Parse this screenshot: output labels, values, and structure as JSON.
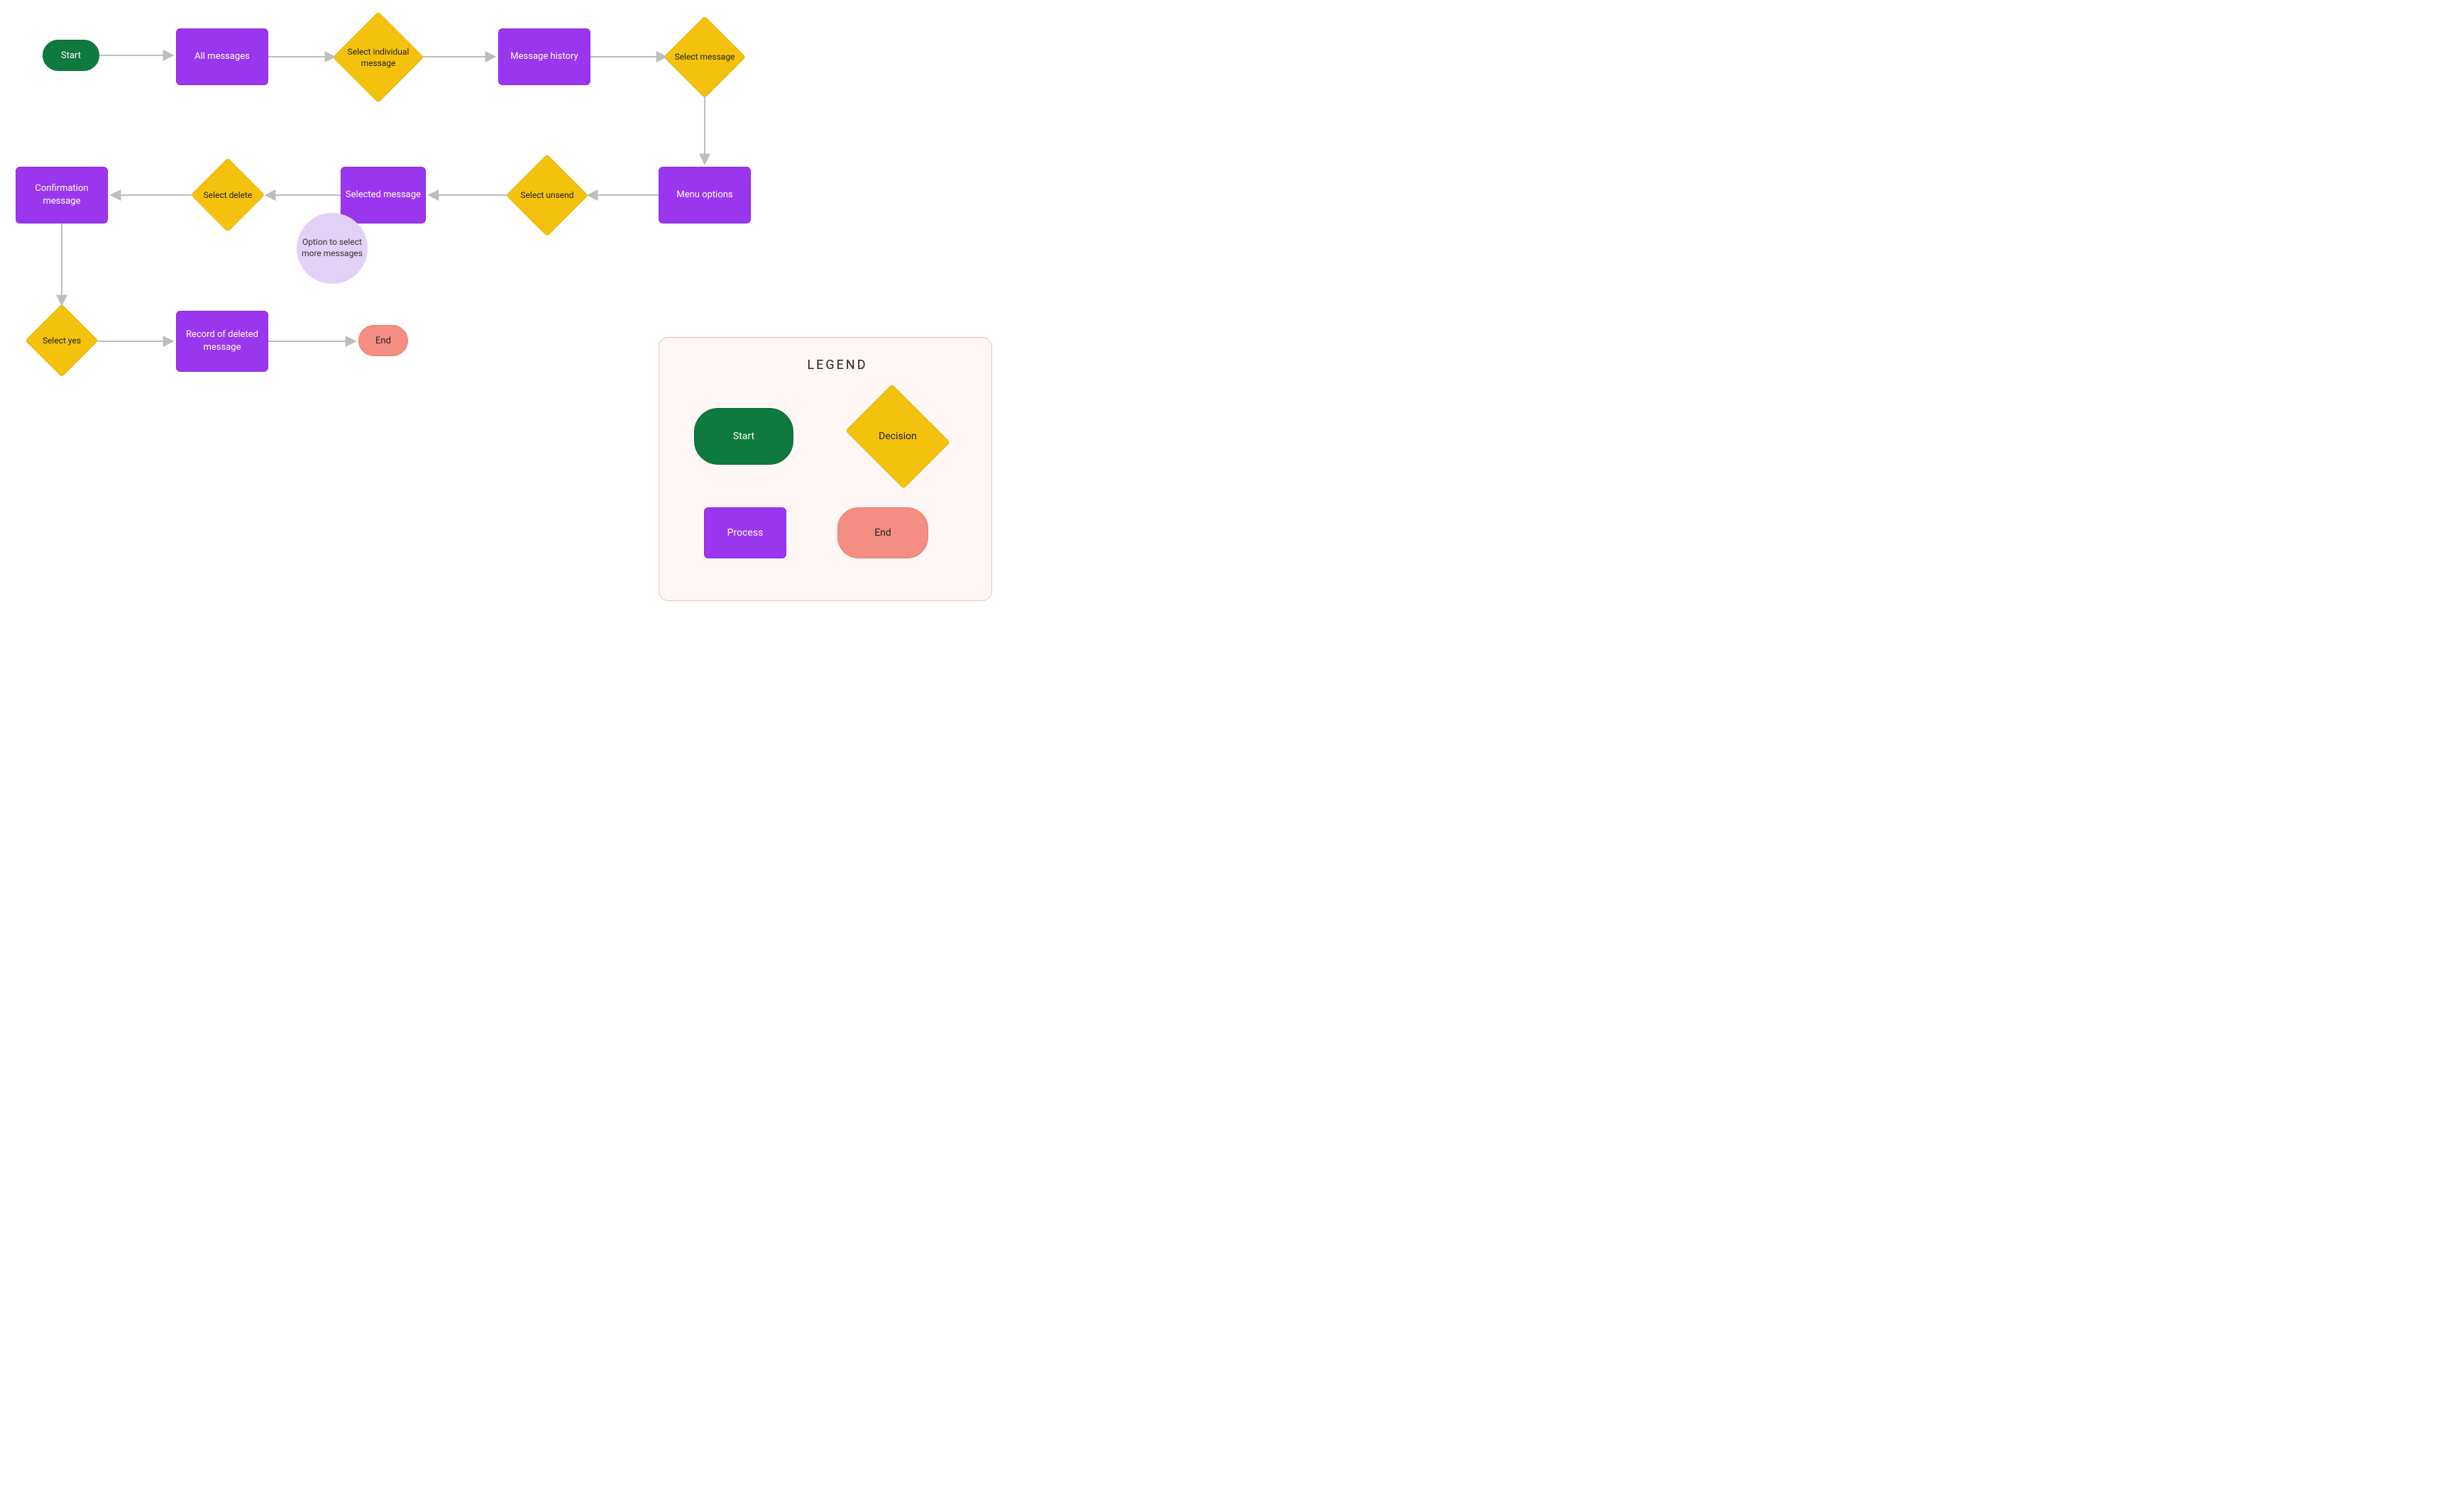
{
  "flow": {
    "start": "Start",
    "all_messages": "All messages",
    "select_individual_message": "Select individual message",
    "message_history": "Message history",
    "select_message": "Select message",
    "menu_options": "Menu options",
    "select_unsend": "Select unsend",
    "selected_message": "Selected message",
    "option_more": "Option to select more messages",
    "select_delete": "Select delete",
    "confirmation_message": "Confirmation message",
    "select_yes": "Select yes",
    "record_deleted": "Record of deleted message",
    "end": "End"
  },
  "legend": {
    "title": "LEGEND",
    "start": "Start",
    "decision": "Decision",
    "process": "Process",
    "end": "End"
  },
  "chart_data": {
    "type": "flowchart",
    "nodes": [
      {
        "id": "start",
        "kind": "start",
        "label": "Start"
      },
      {
        "id": "all_messages",
        "kind": "process",
        "label": "All messages"
      },
      {
        "id": "select_individual_message",
        "kind": "decision",
        "label": "Select individual message"
      },
      {
        "id": "message_history",
        "kind": "process",
        "label": "Message history"
      },
      {
        "id": "select_message",
        "kind": "decision",
        "label": "Select message"
      },
      {
        "id": "menu_options",
        "kind": "process",
        "label": "Menu options"
      },
      {
        "id": "select_unsend",
        "kind": "decision",
        "label": "Select unsend"
      },
      {
        "id": "selected_message",
        "kind": "process",
        "label": "Selected message"
      },
      {
        "id": "option_more",
        "kind": "note",
        "label": "Option to select more messages"
      },
      {
        "id": "select_delete",
        "kind": "decision",
        "label": "Select delete"
      },
      {
        "id": "confirmation_message",
        "kind": "process",
        "label": "Confirmation message"
      },
      {
        "id": "select_yes",
        "kind": "decision",
        "label": "Select yes"
      },
      {
        "id": "record_deleted",
        "kind": "process",
        "label": "Record of deleted message"
      },
      {
        "id": "end",
        "kind": "end",
        "label": "End"
      }
    ],
    "edges": [
      [
        "start",
        "all_messages"
      ],
      [
        "all_messages",
        "select_individual_message"
      ],
      [
        "select_individual_message",
        "message_history"
      ],
      [
        "message_history",
        "select_message"
      ],
      [
        "select_message",
        "menu_options"
      ],
      [
        "menu_options",
        "select_unsend"
      ],
      [
        "select_unsend",
        "selected_message"
      ],
      [
        "selected_message",
        "select_delete"
      ],
      [
        "select_delete",
        "confirmation_message"
      ],
      [
        "confirmation_message",
        "select_yes"
      ],
      [
        "select_yes",
        "record_deleted"
      ],
      [
        "record_deleted",
        "end"
      ]
    ],
    "legend": {
      "start": "Start shape (rounded green)",
      "decision": "Decision shape (yellow diamond)",
      "process": "Process shape (purple rectangle)",
      "end": "End shape (rounded coral)"
    }
  }
}
